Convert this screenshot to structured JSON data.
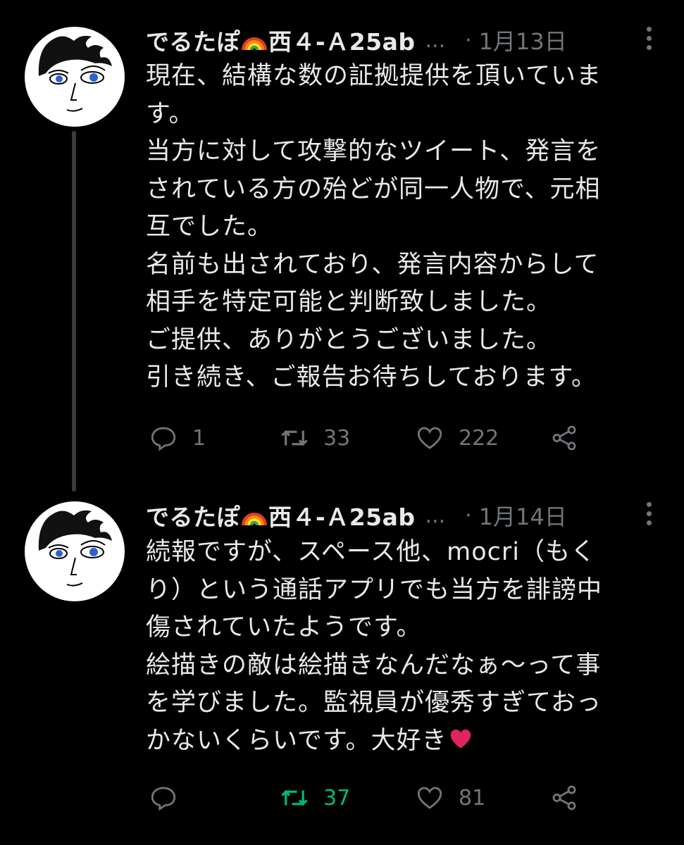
{
  "tweets": [
    {
      "display_name": "でるたぽ",
      "name_suffix": "西４-Ａ25ab",
      "ellipsis": "...",
      "separator": "·",
      "date": "1月13日",
      "lines": [
        "現在、結構な数の証拠提供を頂いていま",
        "す。",
        "当方に対して攻撃的なツイート、発言を",
        "されている方の殆どが同一人物で、元相",
        "互でした。",
        "名前も出されており、発言内容からして",
        "相手を特定可能と判断致しました。",
        "ご提供、ありがとうございました。",
        "引き続き、ご報告お待ちしております。"
      ],
      "reply_count": "1",
      "retweet_count": "33",
      "like_count": "222",
      "retweeted": false
    },
    {
      "display_name": "でるたぽ",
      "name_suffix": "西４-Ａ25ab",
      "ellipsis": "...",
      "separator": "·",
      "date": "1月14日",
      "lines": [
        "続報ですが、スペース他、mocri（もく",
        "り）という通話アプリでも当方を誹謗中",
        "傷されていたようです。",
        "絵描きの敵は絵描きなんだなぁ〜って事",
        "を学びました。監視員が優秀すぎておっ",
        "かないくらいです。大好き"
      ],
      "reply_count": "",
      "retweet_count": "37",
      "like_count": "81",
      "retweeted": true
    }
  ],
  "colors": {
    "background": "#000000",
    "text": "#e7e9ea",
    "muted": "#71767b",
    "retweet_green": "#00ba7c",
    "heart_red": "#e0245e",
    "thread_line": "#3a3c3e"
  },
  "icons": [
    "avatar-illustration",
    "rainbow-emoji",
    "more-icon",
    "reply-icon",
    "retweet-icon",
    "like-icon",
    "share-icon",
    "red-heart-emoji"
  ]
}
